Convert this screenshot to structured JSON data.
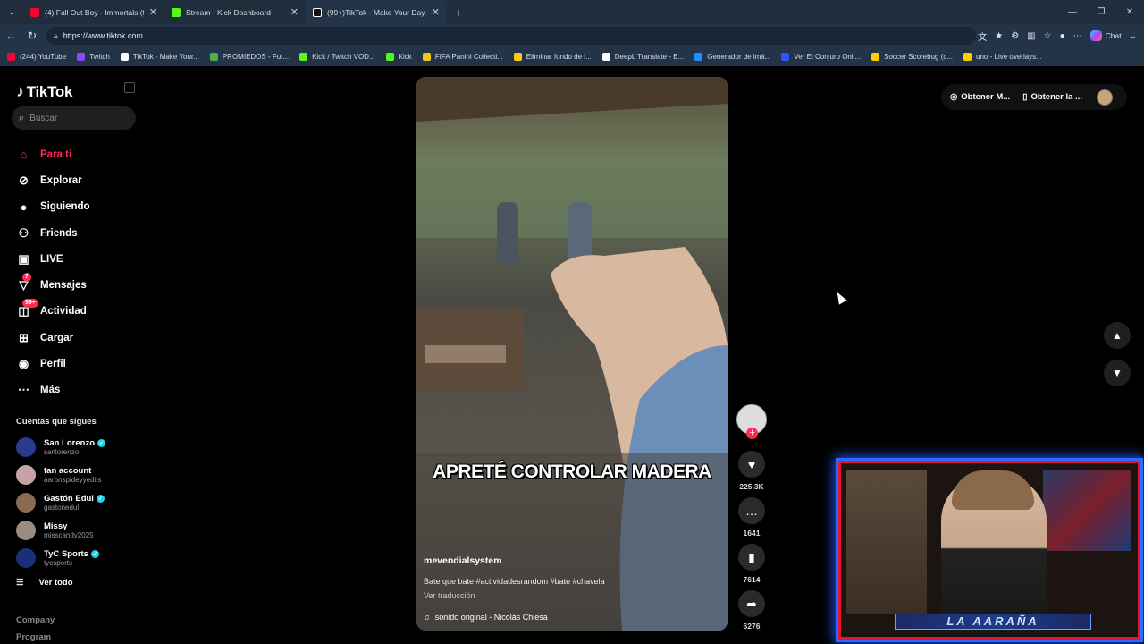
{
  "browser": {
    "tabs": [
      {
        "title": "(4) Fall Out Boy - Immortals (from",
        "color": "#ff0033"
      },
      {
        "title": "Stream - Kick Dashboard",
        "color": "#53fc18"
      },
      {
        "title": "(99+)TikTok - Make Your Day",
        "color": "#ffffff"
      }
    ],
    "url": "https://www.tiktok.com",
    "chat_label": "Chat",
    "bookmarks": [
      {
        "label": "(244) YouTube",
        "color": "#ff0033"
      },
      {
        "label": "Twitch",
        "color": "#9146ff"
      },
      {
        "label": "TikTok - Make Your...",
        "color": "#ffffff"
      },
      {
        "label": "PROMIEDOS - Fut...",
        "color": "#4caf50"
      },
      {
        "label": "Kick / Twitch VOD...",
        "color": "#53fc18"
      },
      {
        "label": "Kick",
        "color": "#53fc18"
      },
      {
        "label": "FIFA Panini Collecti...",
        "color": "#f0c419"
      },
      {
        "label": "Eliminar fondo de i...",
        "color": "#ffcc00"
      },
      {
        "label": "DeepL Translate - E...",
        "color": "#ffffff"
      },
      {
        "label": "Generador de imá...",
        "color": "#1e90ff"
      },
      {
        "label": "Ver El Conjuro Onli...",
        "color": "#3355ff"
      },
      {
        "label": "Soccer Scorebug (c...",
        "color": "#ffcc00"
      },
      {
        "label": "uno - Live overlays...",
        "color": "#ffcc00"
      }
    ]
  },
  "sidebar": {
    "logo": "TikTok",
    "search_placeholder": "Buscar",
    "nav": [
      {
        "label": "Para ti",
        "icon": "home-icon",
        "active": true
      },
      {
        "label": "Explorar",
        "icon": "compass-icon"
      },
      {
        "label": "Siguiendo",
        "icon": "following-avatar-icon"
      },
      {
        "label": "Friends",
        "icon": "friends-icon"
      },
      {
        "label": "LIVE",
        "icon": "live-icon"
      },
      {
        "label": "Mensajes",
        "icon": "messages-icon",
        "badge": "7"
      },
      {
        "label": "Actividad",
        "icon": "activity-icon",
        "badge": "99+"
      },
      {
        "label": "Cargar",
        "icon": "upload-icon"
      },
      {
        "label": "Perfil",
        "icon": "profile-icon"
      },
      {
        "label": "Más",
        "icon": "more-icon"
      }
    ],
    "following_title": "Cuentas que sigues",
    "following": [
      {
        "name": "San Lorenzo",
        "handle": "sanlorenzo",
        "verified": true,
        "color": "#2b3a8f"
      },
      {
        "name": "fan account",
        "handle": "aaronspideyyedits",
        "verified": false,
        "color": "#c7a2a6"
      },
      {
        "name": "Gastón Edul",
        "handle": "gastonedul",
        "verified": true,
        "color": "#8a6b52"
      },
      {
        "name": "Missy",
        "handle": "misscandy2025",
        "verified": false,
        "color": "#9a8b7f"
      },
      {
        "name": "TyC Sports",
        "handle": "tycsports",
        "verified": true,
        "color": "#1a2f7a"
      }
    ],
    "see_all": "Ver todo",
    "footer": [
      "Company",
      "Program"
    ]
  },
  "video": {
    "caption": "APRETÉ CONTROLAR MADERA",
    "author": "mevendialsystem",
    "description": "Bate que bate #actividadesrandom #bate #chavela",
    "translate": "Ver traducción",
    "sound": "sonido original - Nicolás Chiesa"
  },
  "actions": {
    "likes": "225.3K",
    "comments": "1641",
    "saves": "7614",
    "shares": "6276"
  },
  "topright": {
    "get_coins": "Obtener M...",
    "get_app": "Obtener la ..."
  },
  "webcam": {
    "label": "LA AARAÑA"
  }
}
